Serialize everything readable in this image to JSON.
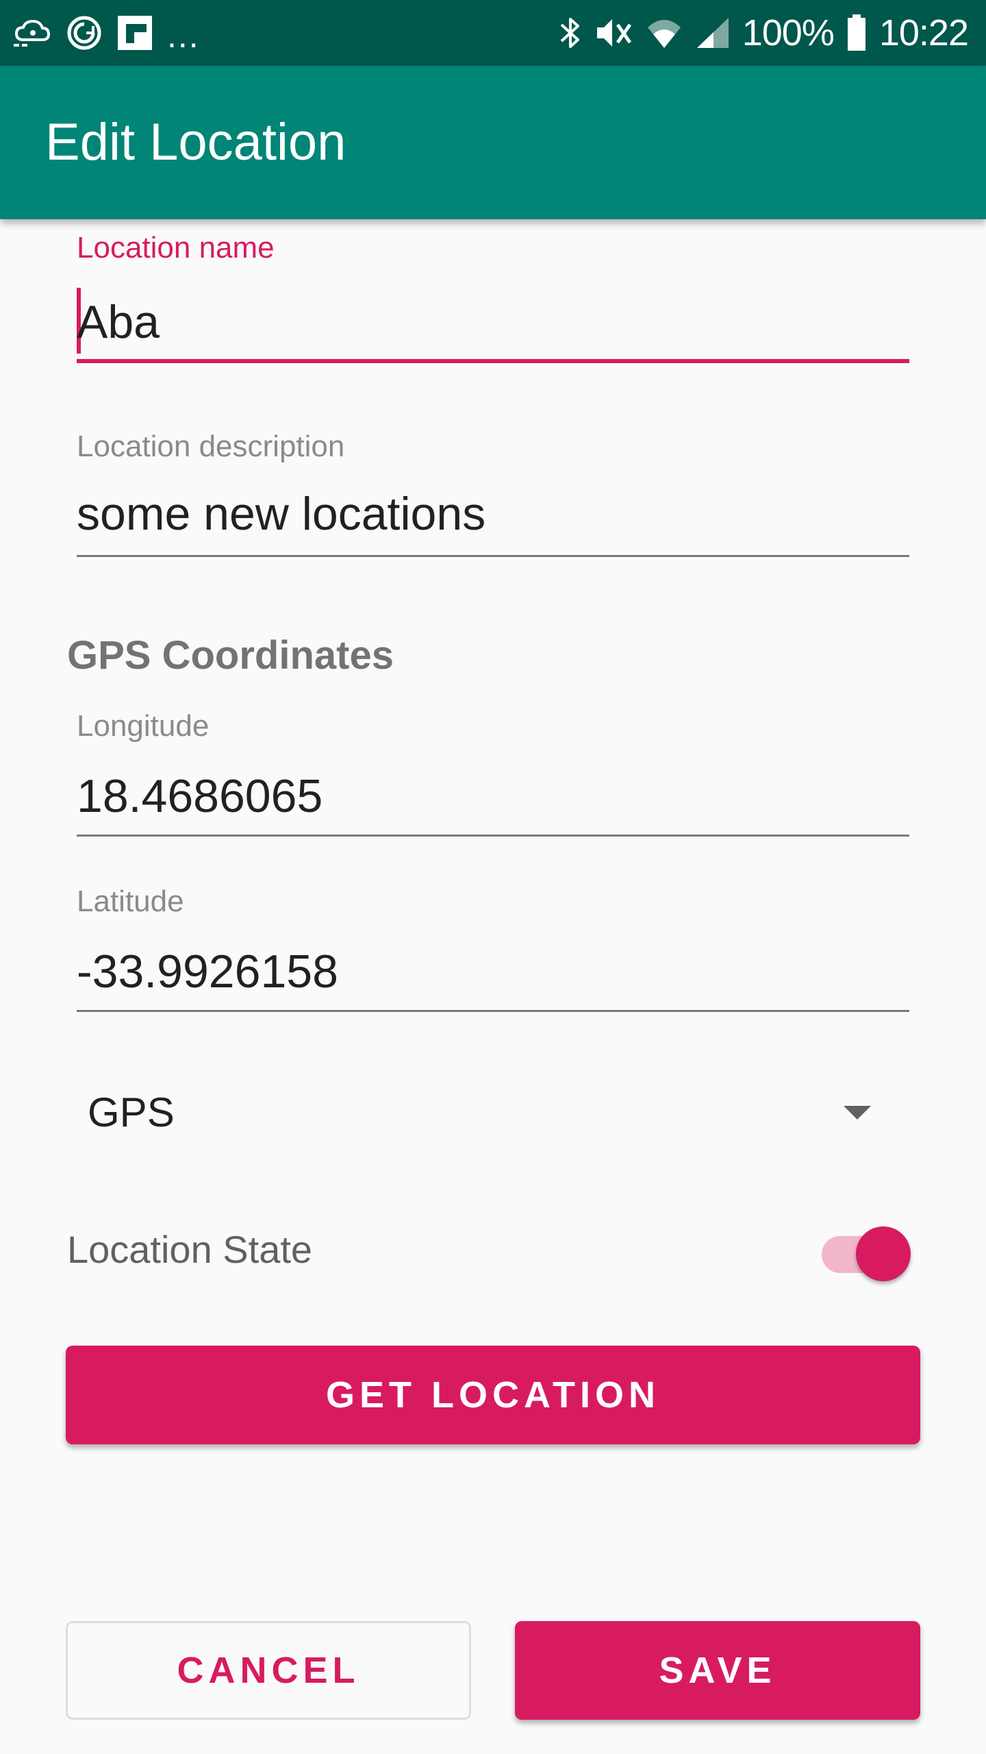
{
  "status_bar": {
    "icons_left": [
      "cloud-sync-icon",
      "reload-app-icon",
      "flipboard-icon"
    ],
    "overflow": "...",
    "icons_right": [
      "bluetooth-icon",
      "mute-vibrate-icon",
      "wifi-icon",
      "cell-signal-icon",
      "battery-icon"
    ],
    "battery": "100%",
    "time": "10:22"
  },
  "app_bar": {
    "title": "Edit Location"
  },
  "form": {
    "name": {
      "label": "Location name",
      "value": "Aba"
    },
    "description": {
      "label": "Location description",
      "value": "some new locations"
    },
    "gps_section_title": "GPS Coordinates",
    "longitude": {
      "label": "Longitude",
      "value": "18.4686065"
    },
    "latitude": {
      "label": "Latitude",
      "value": "-33.9926158"
    },
    "source_spinner": {
      "value": "GPS"
    },
    "state_switch": {
      "label": "Location State",
      "checked": true
    }
  },
  "buttons": {
    "get_location": "GET LOCATION",
    "cancel": "CANCEL",
    "save": "SAVE"
  },
  "colors": {
    "status_bar": "#00574b",
    "app_bar": "#008577",
    "accent": "#d81b60",
    "background": "#fafafa"
  }
}
